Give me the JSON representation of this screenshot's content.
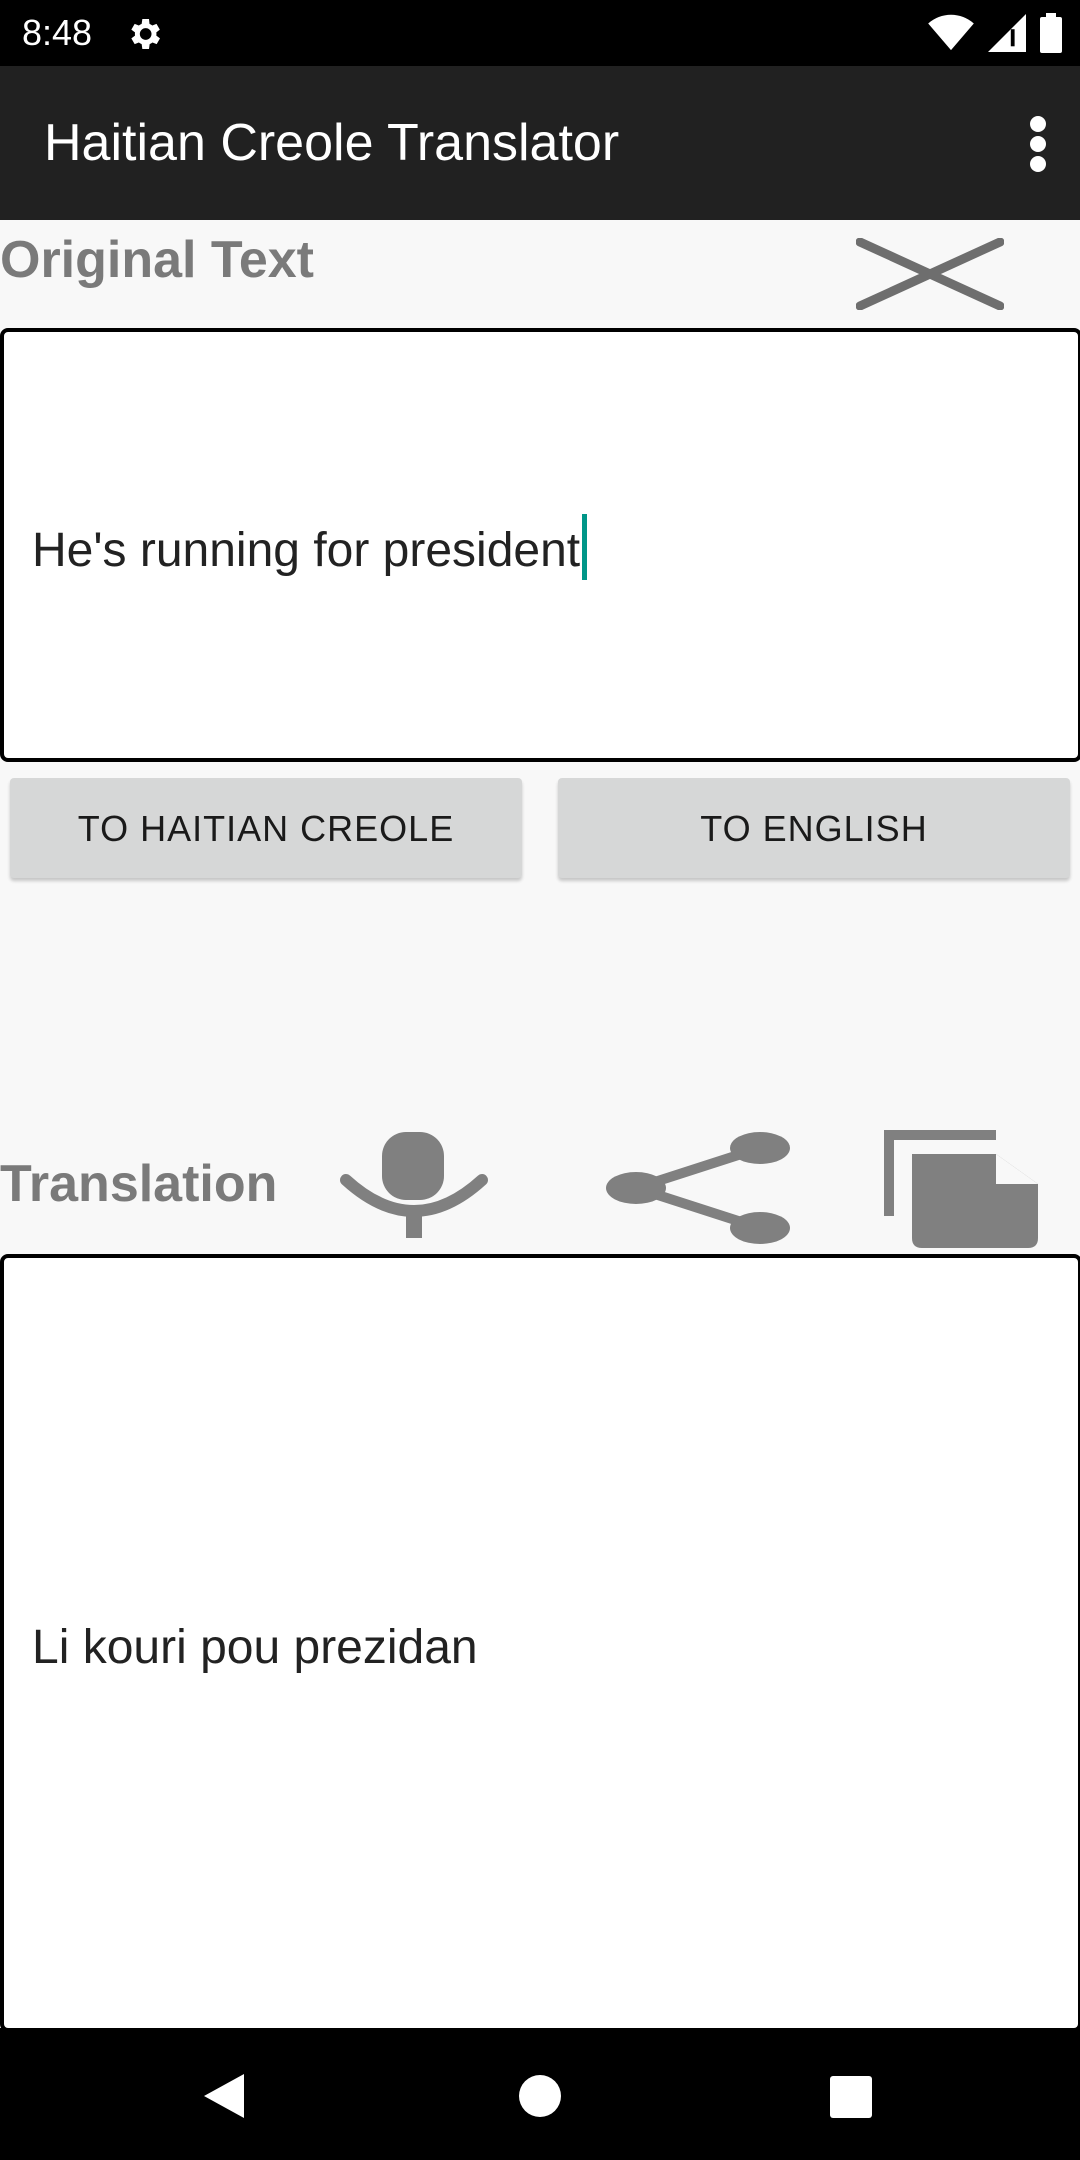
{
  "status_bar": {
    "time": "8:48",
    "icons": [
      "settings-gear-icon",
      "wifi-icon",
      "cell-signal-icon",
      "battery-icon"
    ]
  },
  "app_bar": {
    "title": "Haitian Creole Translator",
    "overflow_icon": "more-vert-icon"
  },
  "original": {
    "label": "Original Text",
    "text": "He's running for president",
    "clear_icon": "close-icon"
  },
  "buttons": {
    "to_creole": "TO HAITIAN CREOLE",
    "to_english": "TO ENGLISH"
  },
  "translation": {
    "label": "Translation",
    "text": "Li kouri pou prezidan",
    "icons": [
      "speaker-icon",
      "share-icon",
      "copy-icon"
    ]
  },
  "nav_bar": {
    "icons": [
      "back-icon",
      "home-icon",
      "recents-icon"
    ]
  },
  "colors": {
    "app_bar": "#212121",
    "label_gray": "#7a7a7a",
    "icon_gray": "#808080",
    "button_bg": "#d6d7d7",
    "cursor": "#009688"
  }
}
